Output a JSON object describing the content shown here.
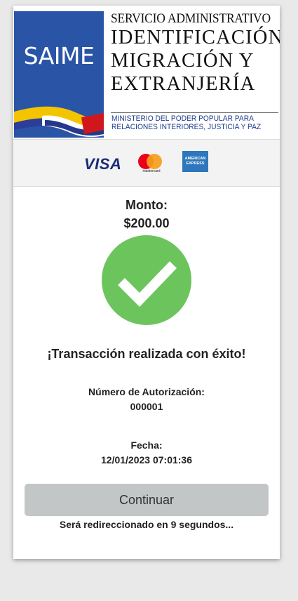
{
  "banner": {
    "logo_text": "SAIME",
    "line1": "SERVICIO ADMINISTRATIVO",
    "line2": "IDENTIFICACIÓN",
    "line3": "MIGRACIÓN Y",
    "line4": "EXTRANJERÍA",
    "ministry": "MINISTERIO DEL PODER POPULAR PARA RELACIONES INTERIORES, JUSTICIA Y PAZ",
    "logo_color": "#2a55a6"
  },
  "payment_brands": {
    "visa": "VISA",
    "mastercard": "mastercard",
    "amex": "AMERICAN EXPRESS"
  },
  "transaction": {
    "amount_label": "Monto:",
    "amount_value": "$200.00",
    "status_icon": "check-circle-icon",
    "status_color": "#6cc55c",
    "success_message": "¡Transacción realizada con éxito!",
    "auth_label": "Número de Autorización:",
    "auth_value": "000001",
    "date_label": "Fecha:",
    "date_value": "12/01/2023 07:01:36"
  },
  "actions": {
    "continue_label": "Continuar",
    "redirect_message": "Será redireccionado en 9 segundos..."
  }
}
